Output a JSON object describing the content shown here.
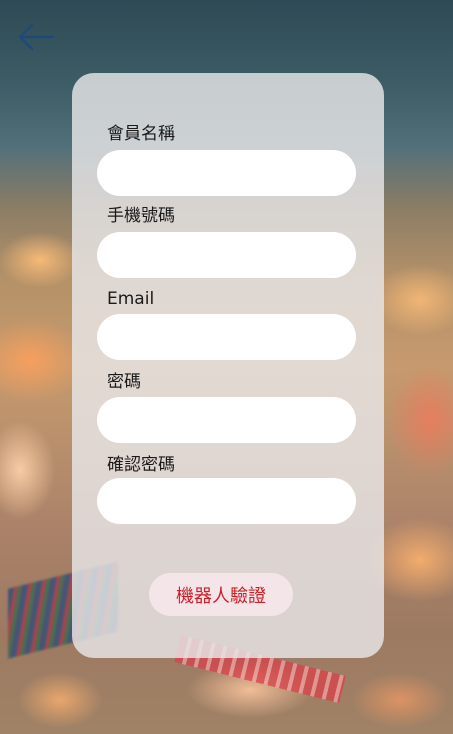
{
  "nav": {
    "back_icon": "arrow-left-icon"
  },
  "form": {
    "member_name_label": "會員名稱",
    "member_name_value": "",
    "phone_label": "手機號碼",
    "phone_value": "",
    "email_label": "Email",
    "email_value": "",
    "password_label": "密碼",
    "password_value": "",
    "confirm_password_label": "確認密碼",
    "confirm_password_value": "",
    "captcha_button_label": "機器人驗證"
  },
  "colors": {
    "accent_red": "#cc1f2a",
    "back_arrow": "#1f4a78",
    "card_bg": "rgba(232,230,232,0.82)"
  }
}
